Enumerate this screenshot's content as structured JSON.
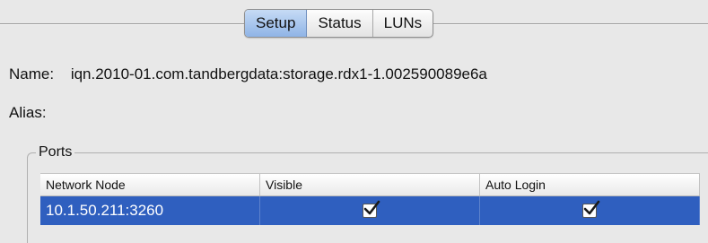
{
  "tabs": [
    {
      "label": "Setup",
      "active": true
    },
    {
      "label": "Status",
      "active": false
    },
    {
      "label": "LUNs",
      "active": false
    }
  ],
  "fields": {
    "name_label": "Name:",
    "name_value": "iqn.2010-01.com.tandbergdata:storage.rdx1-1.002590089e6a",
    "alias_label": "Alias:",
    "alias_value": ""
  },
  "ports": {
    "title": "Ports",
    "columns": [
      "Network Node",
      "Visible",
      "Auto Login"
    ],
    "rows": [
      {
        "network_node": "10.1.50.211:3260",
        "visible": true,
        "auto_login": true
      }
    ]
  },
  "colors": {
    "selection": "#2f5fbf",
    "active_tab": "#8fb4e6"
  }
}
